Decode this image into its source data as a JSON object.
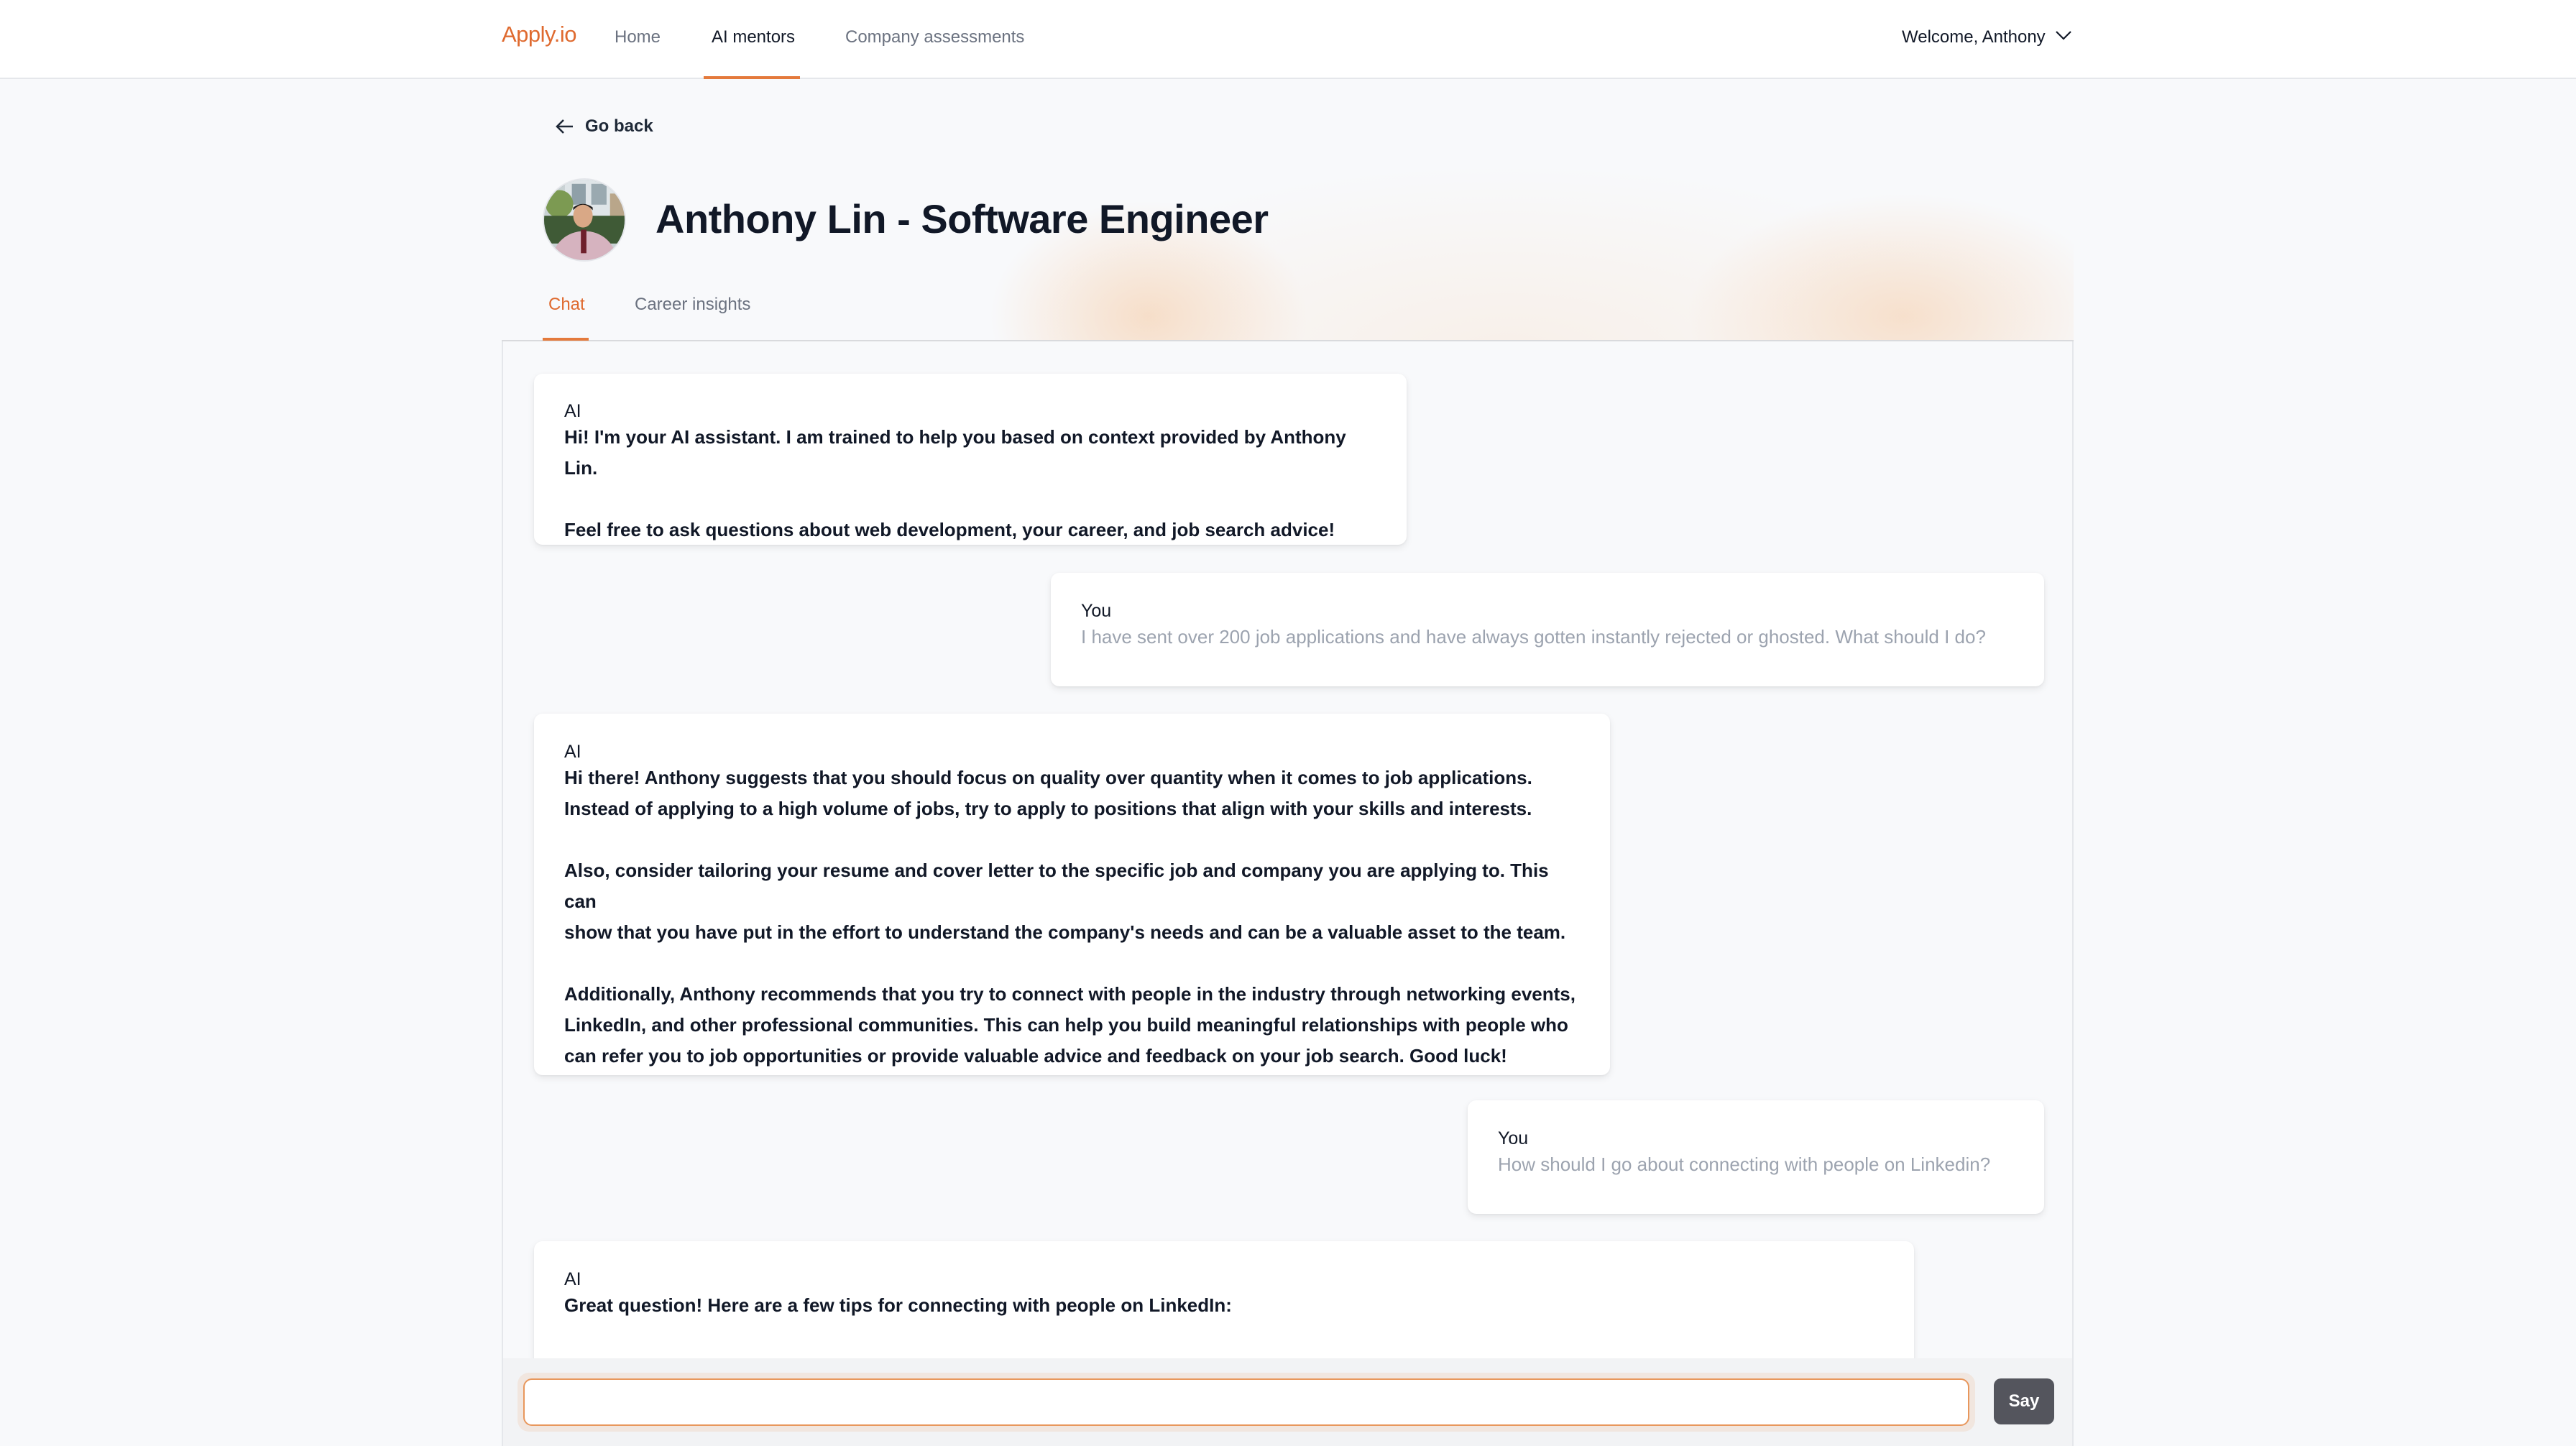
{
  "nav": {
    "brand": "Apply.io",
    "links": [
      {
        "label": "Home",
        "active": false
      },
      {
        "label": "AI mentors",
        "active": true
      },
      {
        "label": "Company assessments",
        "active": false
      }
    ],
    "welcome": "Welcome, Anthony",
    "accent_color": "#e47a3c"
  },
  "header": {
    "go_back_label": "Go back",
    "title": "Anthony Lin - Software Engineer",
    "tabs": [
      {
        "label": "Chat",
        "active": true
      },
      {
        "label": "Career insights",
        "active": false
      }
    ]
  },
  "chat": {
    "messages": [
      {
        "speaker": "AI",
        "text": "Hi! I'm your AI assistant. I am trained to help you based on context provided by Anthony Lin.\n\nFeel free to ask questions about web development, your career, and job search advice!"
      },
      {
        "speaker": "You",
        "text": "I have sent over 200 job applications and have always gotten instantly rejected or ghosted. What should I do?"
      },
      {
        "speaker": "AI",
        "text": "Hi there! Anthony suggests that you should focus on quality over quantity when it comes to job applications.\nInstead of applying to a high volume of jobs, try to apply to positions that align with your skills and interests.\n\nAlso, consider tailoring your resume and cover letter to the specific job and company you are applying to. This can\nshow that you have put in the effort to understand the company's needs and can be a valuable asset to the team.\n\nAdditionally, Anthony recommends that you try to connect with people in the industry through networking events,\nLinkedIn, and other professional communities. This can help you build meaningful relationships with people who\ncan refer you to job opportunities or provide valuable advice and feedback on your job search. Good luck!"
      },
      {
        "speaker": "You",
        "text": "How should I go about connecting with people on Linkedin?"
      },
      {
        "speaker": "AI",
        "text": "Great question! Here are a few tips for connecting with people on LinkedIn:"
      }
    ]
  },
  "composer": {
    "input_value": "",
    "input_placeholder": "",
    "send_label": "Say"
  }
}
